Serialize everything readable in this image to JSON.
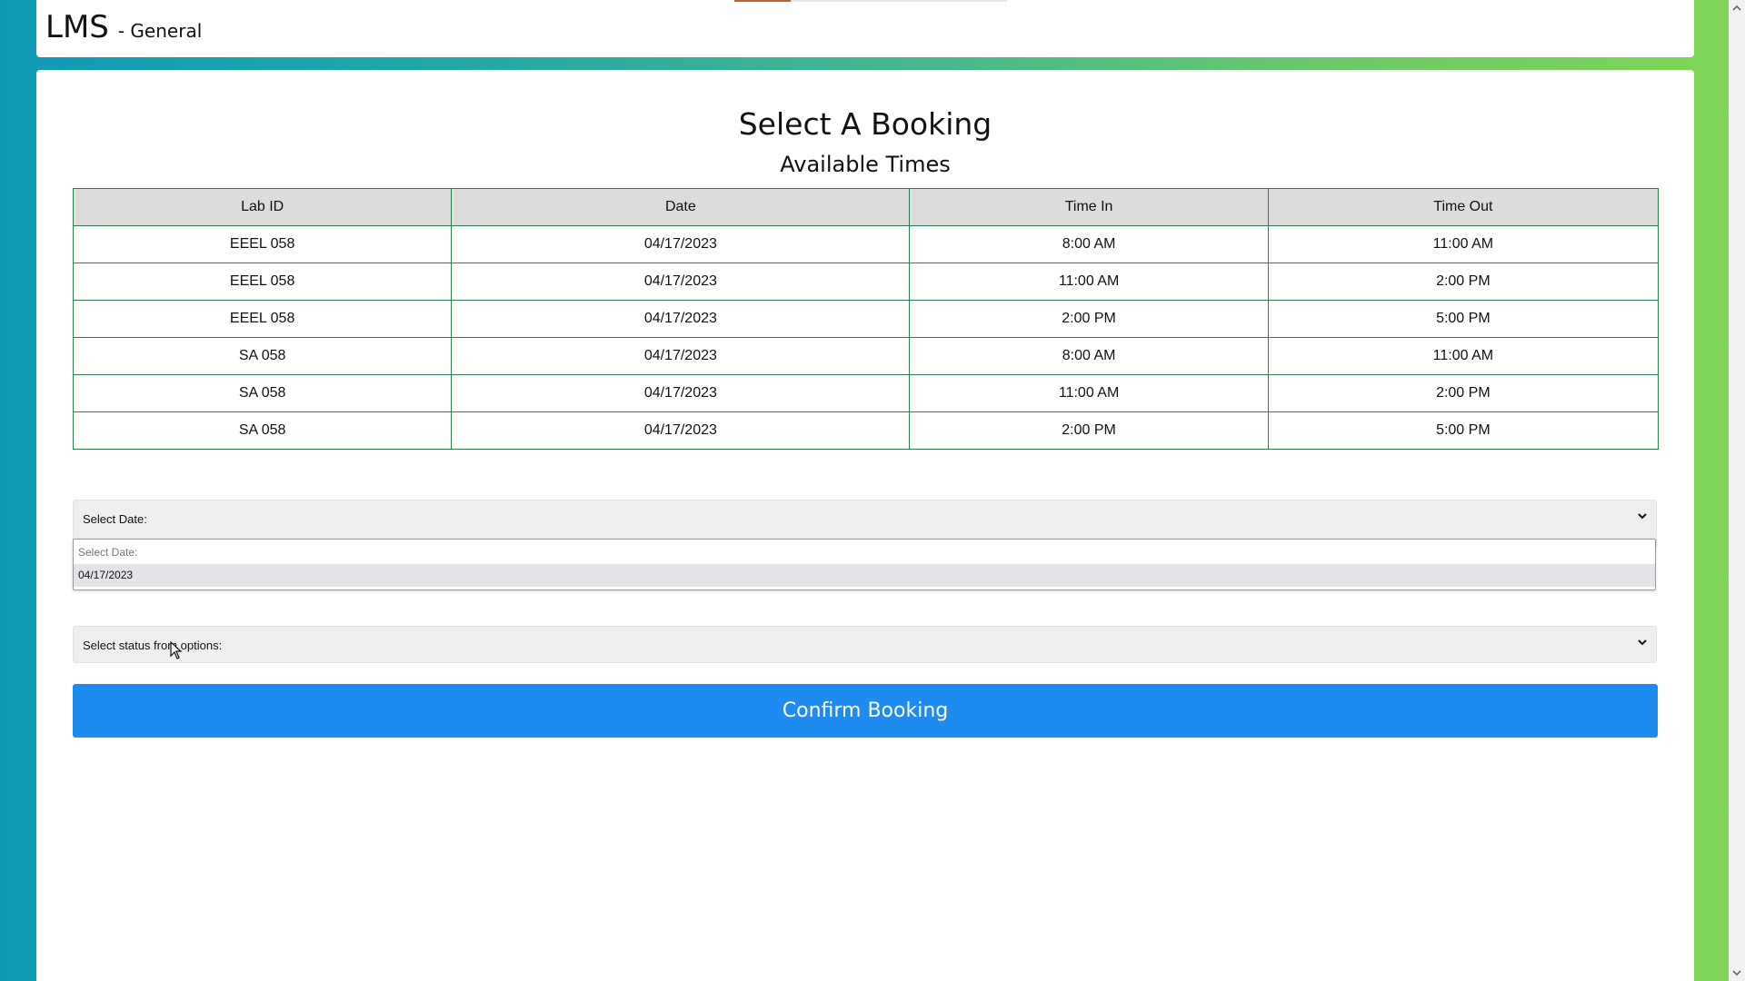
{
  "header": {
    "logo": "LMS",
    "section": "- General"
  },
  "main": {
    "title": "Select A Booking",
    "subtitle": "Available Times"
  },
  "table": {
    "columns": [
      "Lab ID",
      "Date",
      "Time In",
      "Time Out"
    ],
    "rows": [
      [
        "EEEL 058",
        "04/17/2023",
        "8:00 AM",
        "11:00 AM"
      ],
      [
        "EEEL 058",
        "04/17/2023",
        "11:00 AM",
        "2:00 PM"
      ],
      [
        "EEEL 058",
        "04/17/2023",
        "2:00 PM",
        "5:00 PM"
      ],
      [
        "SA 058",
        "04/17/2023",
        "8:00 AM",
        "11:00 AM"
      ],
      [
        "SA 058",
        "04/17/2023",
        "11:00 AM",
        "2:00 PM"
      ],
      [
        "SA 058",
        "04/17/2023",
        "2:00 PM",
        "5:00 PM"
      ]
    ]
  },
  "date_select": {
    "label": "Select Date:",
    "options": [
      "Select Date:",
      "04/17/2023"
    ],
    "highlighted_option": "04/17/2023"
  },
  "status_select": {
    "label": "Select status from options:"
  },
  "confirm_button": {
    "label": "Confirm Booking"
  },
  "colors": {
    "button": "#1e8bf0",
    "table_border": "#2e7d4f",
    "header_row": "#dcdcdc"
  }
}
